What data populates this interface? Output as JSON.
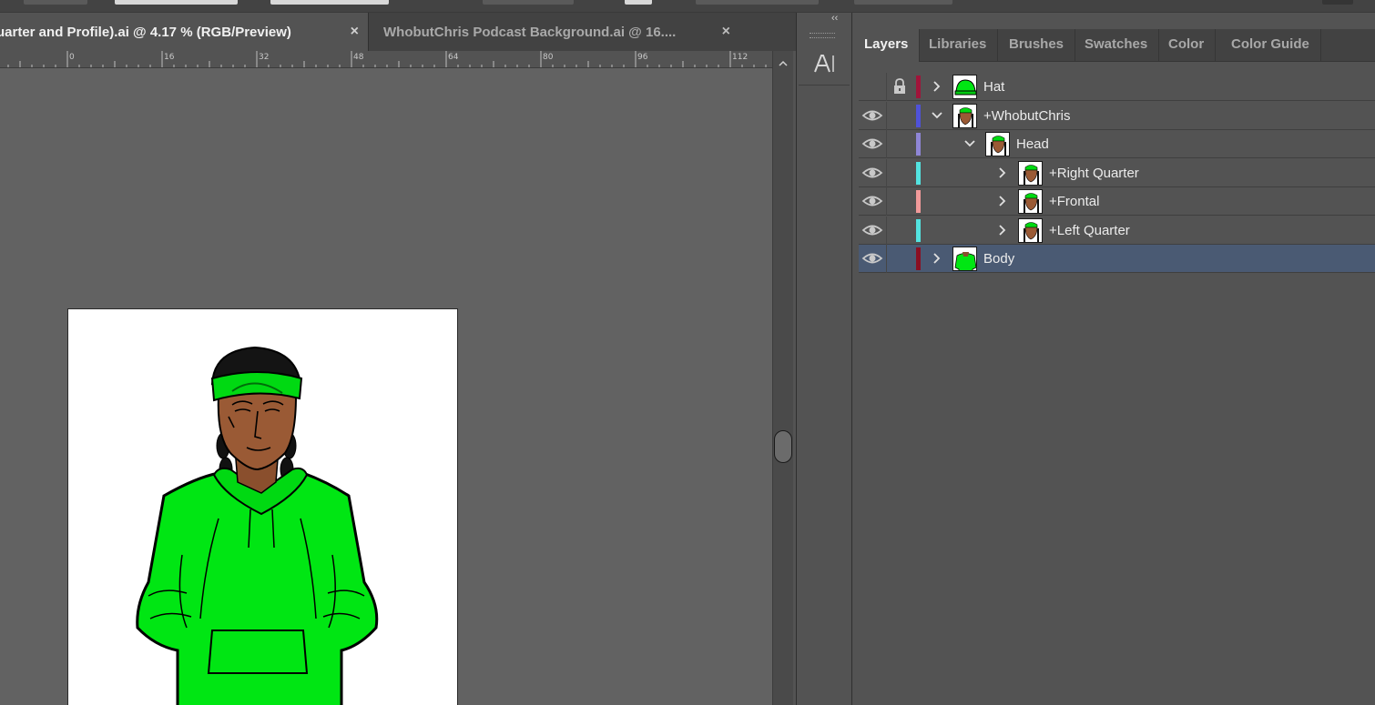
{
  "tabs": {
    "active": {
      "label": "uarter and Profile).ai @ 4.17 % (RGB/Preview)",
      "close": "×"
    },
    "inactive": {
      "label": "WhobutChris Podcast Background.ai @ 16....",
      "close": "×"
    }
  },
  "ruler": {
    "marks": [
      "0",
      "16",
      "32",
      "48",
      "64",
      "80",
      "96",
      "112"
    ]
  },
  "toolstrip": {
    "collapse": "‹‹",
    "tool_glyph": "A|"
  },
  "panel": {
    "tabs": [
      {
        "label": "Layers",
        "active": true
      },
      {
        "label": "Libraries"
      },
      {
        "label": "Brushes"
      },
      {
        "label": "Swatches"
      },
      {
        "label": "Color"
      },
      {
        "label": "Color Guide"
      }
    ]
  },
  "layers": [
    {
      "name": "Hat",
      "visible": false,
      "locked": true,
      "color": "#a0143a",
      "expanded": false,
      "depth": 0,
      "selected": false,
      "thumb": "hat"
    },
    {
      "name": "+WhobutChris",
      "visible": true,
      "locked": false,
      "color": "#4f52d8",
      "expanded": true,
      "depth": 0,
      "selected": false,
      "thumb": "face"
    },
    {
      "name": "Head",
      "visible": true,
      "locked": false,
      "color": "#8f86d6",
      "expanded": true,
      "depth": 1,
      "selected": false,
      "thumb": "face"
    },
    {
      "name": "+Right Quarter",
      "visible": true,
      "locked": false,
      "color": "#53e3e0",
      "expanded": false,
      "depth": 2,
      "selected": false,
      "thumb": "face"
    },
    {
      "name": "+Frontal",
      "visible": true,
      "locked": false,
      "color": "#f19a9a",
      "expanded": false,
      "depth": 2,
      "selected": false,
      "thumb": "face"
    },
    {
      "name": "+Left Quarter",
      "visible": true,
      "locked": false,
      "color": "#53e3e0",
      "expanded": false,
      "depth": 2,
      "selected": false,
      "thumb": "face"
    },
    {
      "name": "Body",
      "visible": true,
      "locked": false,
      "color": "#8a0f22",
      "expanded": false,
      "depth": 0,
      "selected": true,
      "thumb": "body"
    }
  ],
  "colors": {
    "hoodie_green": "#00e613",
    "skin": "#9a5a35",
    "hair": "#111111",
    "selection": "#4a5a73"
  }
}
